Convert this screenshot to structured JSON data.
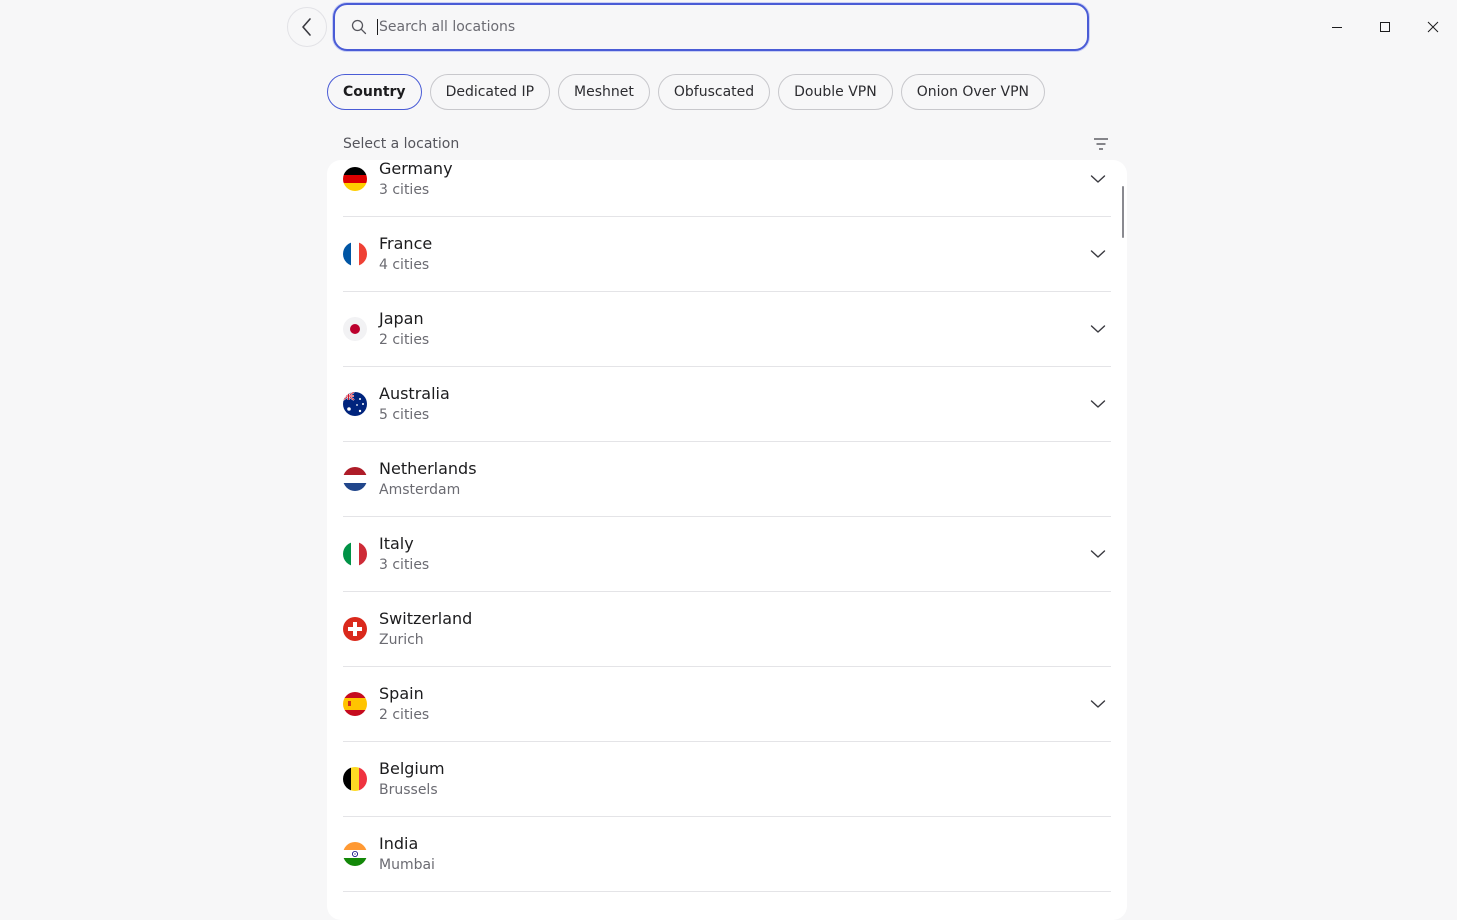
{
  "search": {
    "placeholder": "Search all locations",
    "value": ""
  },
  "filters": [
    {
      "label": "Country",
      "active": true
    },
    {
      "label": "Dedicated IP",
      "active": false
    },
    {
      "label": "Meshnet",
      "active": false
    },
    {
      "label": "Obfuscated",
      "active": false
    },
    {
      "label": "Double VPN",
      "active": false
    },
    {
      "label": "Onion Over VPN",
      "active": false
    }
  ],
  "list": {
    "header": "Select a location",
    "items": [
      {
        "name": "Germany",
        "sub": "3 cities",
        "expandable": true,
        "flag": "germany-flag-icon"
      },
      {
        "name": "France",
        "sub": "4 cities",
        "expandable": true,
        "flag": "france-flag-icon"
      },
      {
        "name": "Japan",
        "sub": "2 cities",
        "expandable": true,
        "flag": "japan-flag-icon"
      },
      {
        "name": "Australia",
        "sub": "5 cities",
        "expandable": true,
        "flag": "australia-flag-icon"
      },
      {
        "name": "Netherlands",
        "sub": "Amsterdam",
        "expandable": false,
        "flag": "netherlands-flag-icon"
      },
      {
        "name": "Italy",
        "sub": "3 cities",
        "expandable": true,
        "flag": "italy-flag-icon"
      },
      {
        "name": "Switzerland",
        "sub": "Zurich",
        "expandable": false,
        "flag": "switzerland-flag-icon"
      },
      {
        "name": "Spain",
        "sub": "2 cities",
        "expandable": true,
        "flag": "spain-flag-icon"
      },
      {
        "name": "Belgium",
        "sub": "Brussels",
        "expandable": false,
        "flag": "belgium-flag-icon"
      },
      {
        "name": "India",
        "sub": "Mumbai",
        "expandable": false,
        "flag": "india-flag-icon"
      }
    ]
  },
  "colors": {
    "accent": "#4a5cd6",
    "background": "#f7f7f8",
    "panel": "#ffffff"
  }
}
